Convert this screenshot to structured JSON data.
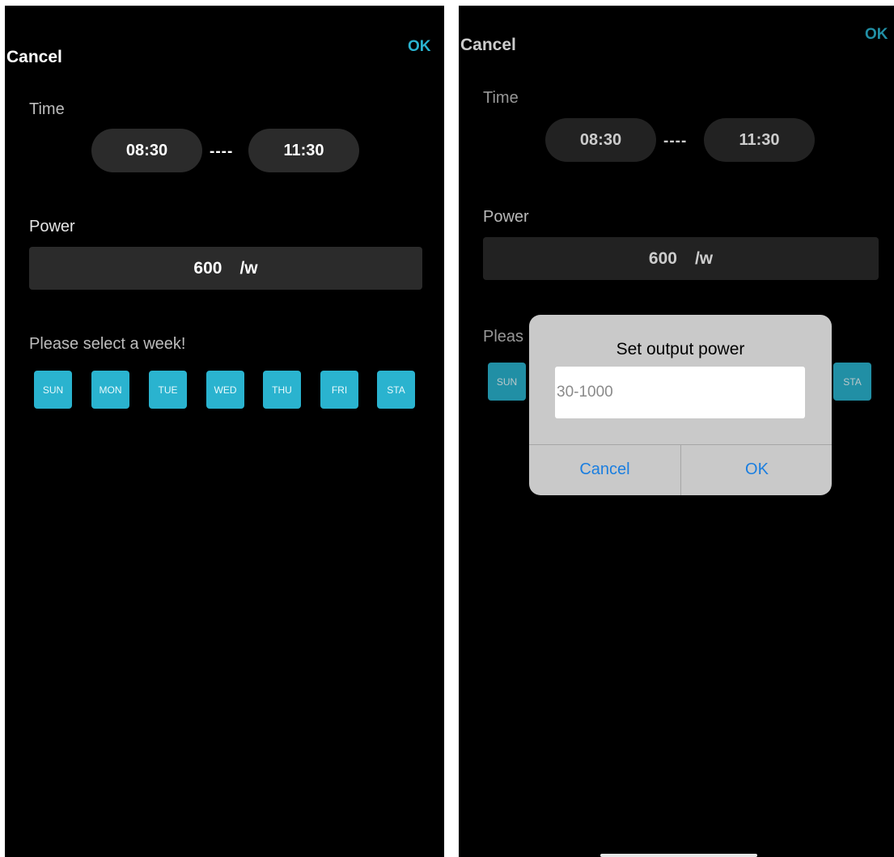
{
  "left": {
    "nav": {
      "cancel": "Cancel",
      "ok": "OK"
    },
    "time": {
      "label": "Time",
      "start": "08:30",
      "separator": "----",
      "end": "11:30"
    },
    "power": {
      "label": "Power",
      "value": "600",
      "unit": "/w"
    },
    "week": {
      "prompt": "Please select a week!",
      "days": [
        "SUN",
        "MON",
        "TUE",
        "WED",
        "THU",
        "FRI",
        "STA"
      ]
    }
  },
  "right": {
    "nav": {
      "cancel": "Cancel",
      "ok": "OK"
    },
    "time": {
      "label": "Time",
      "start": "08:30",
      "separator": "----",
      "end": "11:30"
    },
    "power": {
      "label": "Power",
      "value": "600",
      "unit": "/w"
    },
    "week": {
      "prompt_partial": "Pleas",
      "day_first": "SUN",
      "day_last": "STA"
    },
    "dialog": {
      "title": "Set output power",
      "placeholder": "30-1000",
      "cancel": "Cancel",
      "ok": "OK"
    }
  },
  "colors": {
    "accent": "#2ab3cf",
    "pill": "#2b2b2b",
    "dialog_button": "#1a7ee0"
  }
}
